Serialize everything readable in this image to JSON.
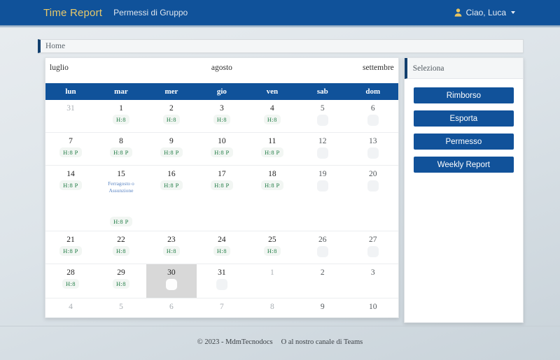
{
  "navbar": {
    "brand": "Time Report",
    "links": [
      {
        "label": "Permessi di Gruppo"
      }
    ],
    "user": {
      "greeting": "Ciao, Luca",
      "icon": "user-icon",
      "caret": "chevron-down-icon"
    },
    "background_color": "#10529a",
    "brand_color": "#e8c96a"
  },
  "breadcrumb": {
    "label": "Home"
  },
  "calendar": {
    "prev_month": "luglio",
    "current_month": "agosto",
    "next_month": "settembre",
    "day_headers": [
      "lun",
      "mar",
      "mer",
      "gio",
      "ven",
      "sab",
      "dom"
    ],
    "header_bg": "#10529a",
    "badge_color": "#1e7b43",
    "holiday_color": "#5c86c4",
    "selected_bg": "#d8d8d8",
    "weeks": [
      {
        "row_class": "",
        "days": [
          {
            "num": "31",
            "out": true,
            "weekend": false,
            "badge": null,
            "holiday": null,
            "selected": false
          },
          {
            "num": "1",
            "out": false,
            "weekend": false,
            "badge": "H:8",
            "holiday": null,
            "selected": false
          },
          {
            "num": "2",
            "out": false,
            "weekend": false,
            "badge": "H:8",
            "holiday": null,
            "selected": false
          },
          {
            "num": "3",
            "out": false,
            "weekend": false,
            "badge": "H:8",
            "holiday": null,
            "selected": false
          },
          {
            "num": "4",
            "out": false,
            "weekend": false,
            "badge": "H:8",
            "holiday": null,
            "selected": false
          },
          {
            "num": "5",
            "out": false,
            "weekend": true,
            "badge": "",
            "holiday": null,
            "selected": false
          },
          {
            "num": "6",
            "out": false,
            "weekend": true,
            "badge": "",
            "holiday": null,
            "selected": false
          }
        ]
      },
      {
        "row_class": "",
        "days": [
          {
            "num": "7",
            "out": false,
            "weekend": false,
            "badge": "H:8 P",
            "holiday": null,
            "selected": false
          },
          {
            "num": "8",
            "out": false,
            "weekend": false,
            "badge": "H:8 P",
            "holiday": null,
            "selected": false
          },
          {
            "num": "9",
            "out": false,
            "weekend": false,
            "badge": "H:8 P",
            "holiday": null,
            "selected": false
          },
          {
            "num": "10",
            "out": false,
            "weekend": false,
            "badge": "H:8 P",
            "holiday": null,
            "selected": false
          },
          {
            "num": "11",
            "out": false,
            "weekend": false,
            "badge": "H:8 P",
            "holiday": null,
            "selected": false
          },
          {
            "num": "12",
            "out": false,
            "weekend": true,
            "badge": "",
            "holiday": null,
            "selected": false
          },
          {
            "num": "13",
            "out": false,
            "weekend": true,
            "badge": "",
            "holiday": null,
            "selected": false
          }
        ]
      },
      {
        "row_class": "tall",
        "days": [
          {
            "num": "14",
            "out": false,
            "weekend": false,
            "badge": "H:8 P",
            "holiday": null,
            "selected": false
          },
          {
            "num": "15",
            "out": false,
            "weekend": false,
            "badge": "H:8 P",
            "holiday": "Ferragosto o Assunzione",
            "selected": false
          },
          {
            "num": "16",
            "out": false,
            "weekend": false,
            "badge": "H:8 P",
            "holiday": null,
            "selected": false
          },
          {
            "num": "17",
            "out": false,
            "weekend": false,
            "badge": "H:8 P",
            "holiday": null,
            "selected": false
          },
          {
            "num": "18",
            "out": false,
            "weekend": false,
            "badge": "H:8 P",
            "holiday": null,
            "selected": false
          },
          {
            "num": "19",
            "out": false,
            "weekend": true,
            "badge": "",
            "holiday": null,
            "selected": false
          },
          {
            "num": "20",
            "out": false,
            "weekend": true,
            "badge": "",
            "holiday": null,
            "selected": false
          }
        ]
      },
      {
        "row_class": "",
        "days": [
          {
            "num": "21",
            "out": false,
            "weekend": false,
            "badge": "H:8 P",
            "holiday": null,
            "selected": false
          },
          {
            "num": "22",
            "out": false,
            "weekend": false,
            "badge": "H:8",
            "holiday": null,
            "selected": false
          },
          {
            "num": "23",
            "out": false,
            "weekend": false,
            "badge": "H:8",
            "holiday": null,
            "selected": false
          },
          {
            "num": "24",
            "out": false,
            "weekend": false,
            "badge": "H:8",
            "holiday": null,
            "selected": false
          },
          {
            "num": "25",
            "out": false,
            "weekend": false,
            "badge": "H:8",
            "holiday": null,
            "selected": false
          },
          {
            "num": "26",
            "out": false,
            "weekend": true,
            "badge": "",
            "holiday": null,
            "selected": false
          },
          {
            "num": "27",
            "out": false,
            "weekend": true,
            "badge": "",
            "holiday": null,
            "selected": false
          }
        ]
      },
      {
        "row_class": "mid",
        "days": [
          {
            "num": "28",
            "out": false,
            "weekend": false,
            "badge": "H:8",
            "holiday": null,
            "selected": false
          },
          {
            "num": "29",
            "out": false,
            "weekend": false,
            "badge": "H:8",
            "holiday": null,
            "selected": false
          },
          {
            "num": "30",
            "out": false,
            "weekend": false,
            "badge": "",
            "holiday": null,
            "selected": true
          },
          {
            "num": "31",
            "out": false,
            "weekend": false,
            "badge": "",
            "holiday": null,
            "selected": false
          },
          {
            "num": "1",
            "out": true,
            "weekend": false,
            "badge": null,
            "holiday": null,
            "selected": false
          },
          {
            "num": "2",
            "out": true,
            "weekend": true,
            "badge": null,
            "holiday": null,
            "selected": false
          },
          {
            "num": "3",
            "out": true,
            "weekend": true,
            "badge": null,
            "holiday": null,
            "selected": false
          }
        ]
      },
      {
        "row_class": "short",
        "days": [
          {
            "num": "4",
            "out": true,
            "weekend": false,
            "badge": null,
            "holiday": null,
            "selected": false
          },
          {
            "num": "5",
            "out": true,
            "weekend": false,
            "badge": null,
            "holiday": null,
            "selected": false
          },
          {
            "num": "6",
            "out": true,
            "weekend": false,
            "badge": null,
            "holiday": null,
            "selected": false
          },
          {
            "num": "7",
            "out": true,
            "weekend": false,
            "badge": null,
            "holiday": null,
            "selected": false
          },
          {
            "num": "8",
            "out": true,
            "weekend": false,
            "badge": null,
            "holiday": null,
            "selected": false
          },
          {
            "num": "9",
            "out": true,
            "weekend": true,
            "badge": null,
            "holiday": null,
            "selected": false
          },
          {
            "num": "10",
            "out": true,
            "weekend": true,
            "badge": null,
            "holiday": null,
            "selected": false
          }
        ]
      }
    ]
  },
  "side_panel": {
    "title": "Seleziona",
    "buttons": [
      {
        "label": "Rimborso"
      },
      {
        "label": "Esporta"
      },
      {
        "label": "Permesso"
      },
      {
        "label": "Weekly Report"
      }
    ],
    "button_color": "#11529a"
  },
  "footer": {
    "copyright": "© 2023 - MdmTecnodocs",
    "link": "O al nostro canale di Teams"
  }
}
